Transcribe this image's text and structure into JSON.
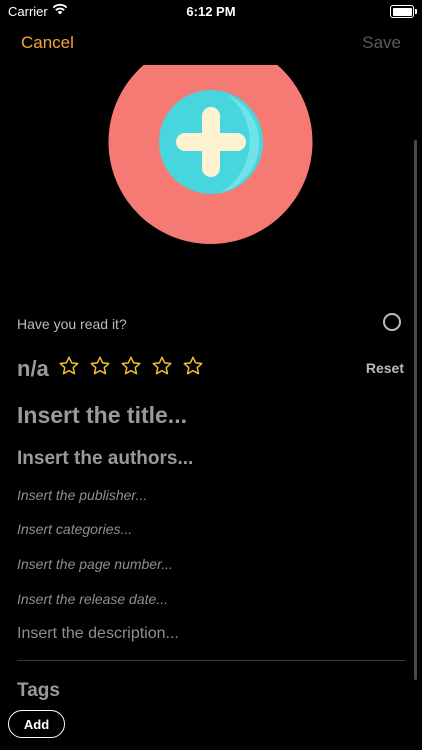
{
  "status_bar": {
    "carrier": "Carrier",
    "time": "6:12 PM"
  },
  "nav": {
    "cancel_label": "Cancel",
    "save_label": "Save"
  },
  "form": {
    "read_question": "Have you read it?",
    "rating_value": "n/a",
    "rating": {
      "filled": 0,
      "max": 5
    },
    "reset_label": "Reset",
    "title_placeholder": "Insert the title...",
    "authors_placeholder": "Insert the authors...",
    "publisher_placeholder": "Insert the publisher...",
    "categories_placeholder": "Insert categories...",
    "page_number_placeholder": "Insert the page number...",
    "release_date_placeholder": "Insert the release date...",
    "description_placeholder": "Insert the description..."
  },
  "tags": {
    "heading": "Tags",
    "add_label": "Add"
  },
  "colors": {
    "accent": "#f2a53a",
    "cover_bg": "#f57a73",
    "plus_circle": "#48d6de",
    "star": "#f4c12e"
  },
  "icons": {
    "cover": "add-cover-icon",
    "star": "star-outline-icon",
    "read": "circle-toggle-icon"
  }
}
